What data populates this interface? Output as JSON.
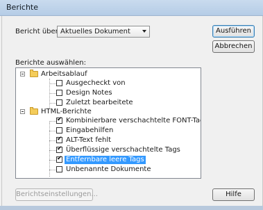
{
  "window": {
    "title": "Berichte"
  },
  "report_on": {
    "label": "Bericht über:",
    "value": "Aktuelles Dokument"
  },
  "select_label": "Berichte auswählen:",
  "buttons": {
    "run": "Ausführen",
    "cancel": "Abbrechen",
    "settings": "Berichtseinstellungen...",
    "help": "Hilfe"
  },
  "tree": {
    "groups": [
      {
        "label": "Arbeitsablauf",
        "items": [
          {
            "label": "Ausgecheckt von",
            "checked": false
          },
          {
            "label": "Design Notes",
            "checked": false
          },
          {
            "label": "Zuletzt bearbeitete",
            "checked": false
          }
        ]
      },
      {
        "label": "HTML-Berichte",
        "items": [
          {
            "label": "Kombinierbare verschachtelte FONT-Tags",
            "checked": true
          },
          {
            "label": "Eingabehilfen",
            "checked": false
          },
          {
            "label": "ALT-Text fehlt",
            "checked": true
          },
          {
            "label": "Überflüssige verschachtelte Tags",
            "checked": true
          },
          {
            "label": "Entfernbare leere Tags",
            "checked": true,
            "selected": true
          },
          {
            "label": "Unbenannte Dokumente",
            "checked": false
          }
        ]
      }
    ]
  }
}
